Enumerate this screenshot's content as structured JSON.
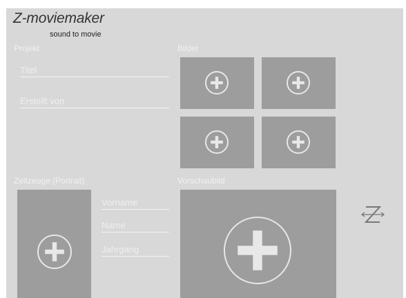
{
  "brand": {
    "title": "Z-moviemaker",
    "subtitle": "sound to movie"
  },
  "projekt": {
    "label": "Projekt",
    "title_placeholder": "Titel",
    "author_placeholder": "Erstellt von"
  },
  "bilder": {
    "label": "Bilder",
    "tiles": [
      "add-image-icon",
      "add-image-icon",
      "add-image-icon",
      "add-image-icon"
    ]
  },
  "zeitzeuge": {
    "label": "Zeitzeuge (Portrait)",
    "firstname_placeholder": "Vorname",
    "name_placeholder": "Name",
    "year_placeholder": "Jahrgang"
  },
  "vorschau": {
    "label": "Vorschaubild"
  },
  "colors": {
    "background": "#d8d8d8",
    "tile": "#9d9d9d",
    "plus": "#e8e8e8"
  }
}
